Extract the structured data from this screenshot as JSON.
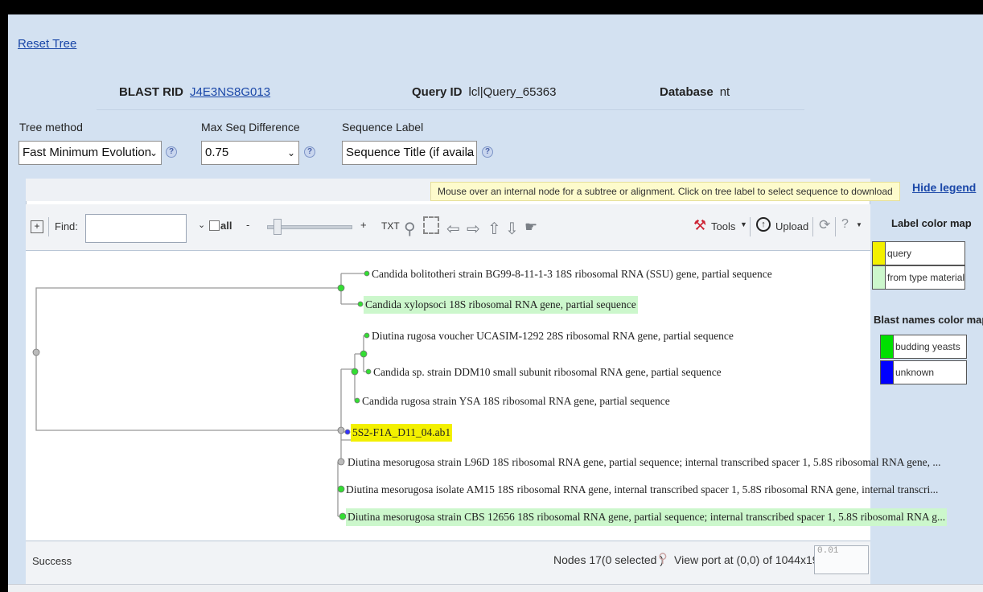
{
  "reset_tree": "Reset Tree",
  "info": {
    "blast_rid_label": "BLAST RID",
    "blast_rid_value": "J4E3NS8G013",
    "query_id_label": "Query ID",
    "query_id_value": "lcl|Query_65363",
    "database_label": "Database",
    "database_value": "nt"
  },
  "controls": {
    "tree_method_label": "Tree method",
    "tree_method_value": "Fast Minimum Evolution",
    "max_seq_label": "Max Seq Difference",
    "max_seq_value": "0.75",
    "seq_label_label": "Sequence Label",
    "seq_label_value": "Sequence Title (if availa"
  },
  "message": "Mouse over an internal node for a subtree or alignment. Click on tree label to select sequence to download",
  "toolbar": {
    "find_label": "Find:",
    "find_value": "",
    "all_label": "all",
    "minus": "-",
    "plus": "+",
    "txt": "TXT",
    "tools_label": "Tools",
    "upload_label": "Upload"
  },
  "tree": {
    "leaves": [
      "Candida bolitotheri strain BG99-8-11-1-3 18S ribosomal RNA (SSU) gene, partial sequence",
      "Candida xylopsoci 18S ribosomal RNA gene, partial sequence",
      "Diutina rugosa voucher UCASIM-1292 28S ribosomal RNA gene, partial sequence",
      "Candida sp. strain DDM10 small subunit ribosomal RNA gene, partial sequence",
      "Candida rugosa strain YSA 18S ribosomal RNA gene, partial sequence",
      "5S2-F1A_D11_04.ab1",
      "Diutina mesorugosa strain L96D 18S ribosomal RNA gene, partial sequence; internal transcribed spacer 1, 5.8S ribosomal RNA gene, ...",
      "Diutina mesorugosa isolate AM15 18S ribosomal RNA gene, internal transcribed spacer 1, 5.8S ribosomal RNA gene, internal transcri...",
      "Diutina mesorugosa strain CBS 12656 18S ribosomal RNA gene, partial sequence; internal transcribed spacer 1, 5.8S ribosomal RNA g..."
    ]
  },
  "status": {
    "text": "Success",
    "nodes": "Nodes 17(0 selected )",
    "viewport": "View port at (0,0)  of 1044x191",
    "scale": "0.01"
  },
  "legend": {
    "hide": "Hide legend",
    "label_map_title": "Label color map",
    "label_items": [
      {
        "label": "query",
        "color": "#f3f000"
      },
      {
        "label": "from type material",
        "color": "#ccf7cc"
      }
    ],
    "blast_map_title": "Blast names color map",
    "blast_items": [
      {
        "label": "budding yeasts",
        "color": "#00e000"
      },
      {
        "label": "unknown",
        "color": "#0000ff"
      }
    ]
  }
}
